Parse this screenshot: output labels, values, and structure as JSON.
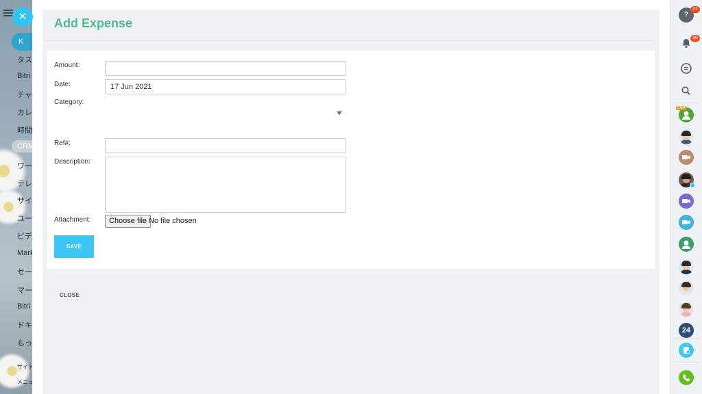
{
  "background_sidebar": {
    "top_pill_label": "K",
    "crm_pill_label": "CRM",
    "items": [
      "タス",
      "Bitri",
      "チャ",
      "カレ",
      "時間",
      "ワー",
      "テレ",
      "サイ",
      "ユー",
      "ビデ",
      "Mark",
      "セー",
      "マー",
      "Bitri",
      "ドキ",
      "もっ"
    ],
    "small_items": [
      "サイト",
      "メニュ"
    ]
  },
  "panel": {
    "title": "Add Expense",
    "form": {
      "amount": {
        "label": "Amount:",
        "value": ""
      },
      "date": {
        "label": "Date:",
        "value": "17 Jun 2021"
      },
      "category": {
        "label": "Category:",
        "value": ""
      },
      "ref": {
        "label": "Ref#:",
        "value": ""
      },
      "description": {
        "label": "Description:",
        "value": ""
      },
      "attachment": {
        "label": "Attachment:",
        "button_label": "Choose file",
        "status": "No file chosen"
      },
      "save_label": "SAVE"
    },
    "close_label": "CLOSE"
  },
  "right_rail": {
    "help_badge": "21",
    "notifications_badge": "86",
    "crm_tag": "CRM",
    "open_channels_label": "24"
  },
  "colors": {
    "title_green": "#54b98b",
    "accent_blue": "#3bc8f5",
    "badge_red": "#f54819",
    "panel_bg": "#eef2f4"
  },
  "icons": [
    "menu-icon",
    "close-icon",
    "help-icon",
    "bell-icon",
    "chat-icon",
    "search-icon",
    "video-icon",
    "phone-icon",
    "dropdown-arrow-icon"
  ]
}
